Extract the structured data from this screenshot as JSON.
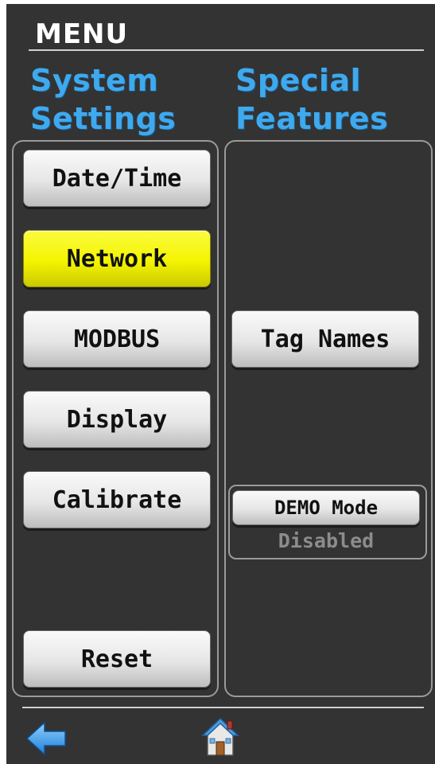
{
  "header": {
    "title": "MENU"
  },
  "system_settings": {
    "heading_line1": "System",
    "heading_line2": "Settings",
    "buttons": [
      {
        "label": "Date/Time",
        "active": false
      },
      {
        "label": "Network",
        "active": true
      },
      {
        "label": "MODBUS",
        "active": false
      },
      {
        "label": "Display",
        "active": false
      },
      {
        "label": "Calibrate",
        "active": false
      },
      {
        "label": "Reset",
        "active": false
      }
    ]
  },
  "special_features": {
    "heading_line1": "Special",
    "heading_line2": "Features",
    "tag_names_label": "Tag Names",
    "demo_mode": {
      "label": "DEMO Mode",
      "status": "Disabled"
    }
  },
  "footer": {
    "back_icon": "back-arrow-icon",
    "home_icon": "home-icon"
  },
  "colors": {
    "background": "#333333",
    "heading": "#3fa9ee",
    "active_button": "#f4f400",
    "button": "#e6e6e6",
    "status_text": "#8c8c8c"
  }
}
